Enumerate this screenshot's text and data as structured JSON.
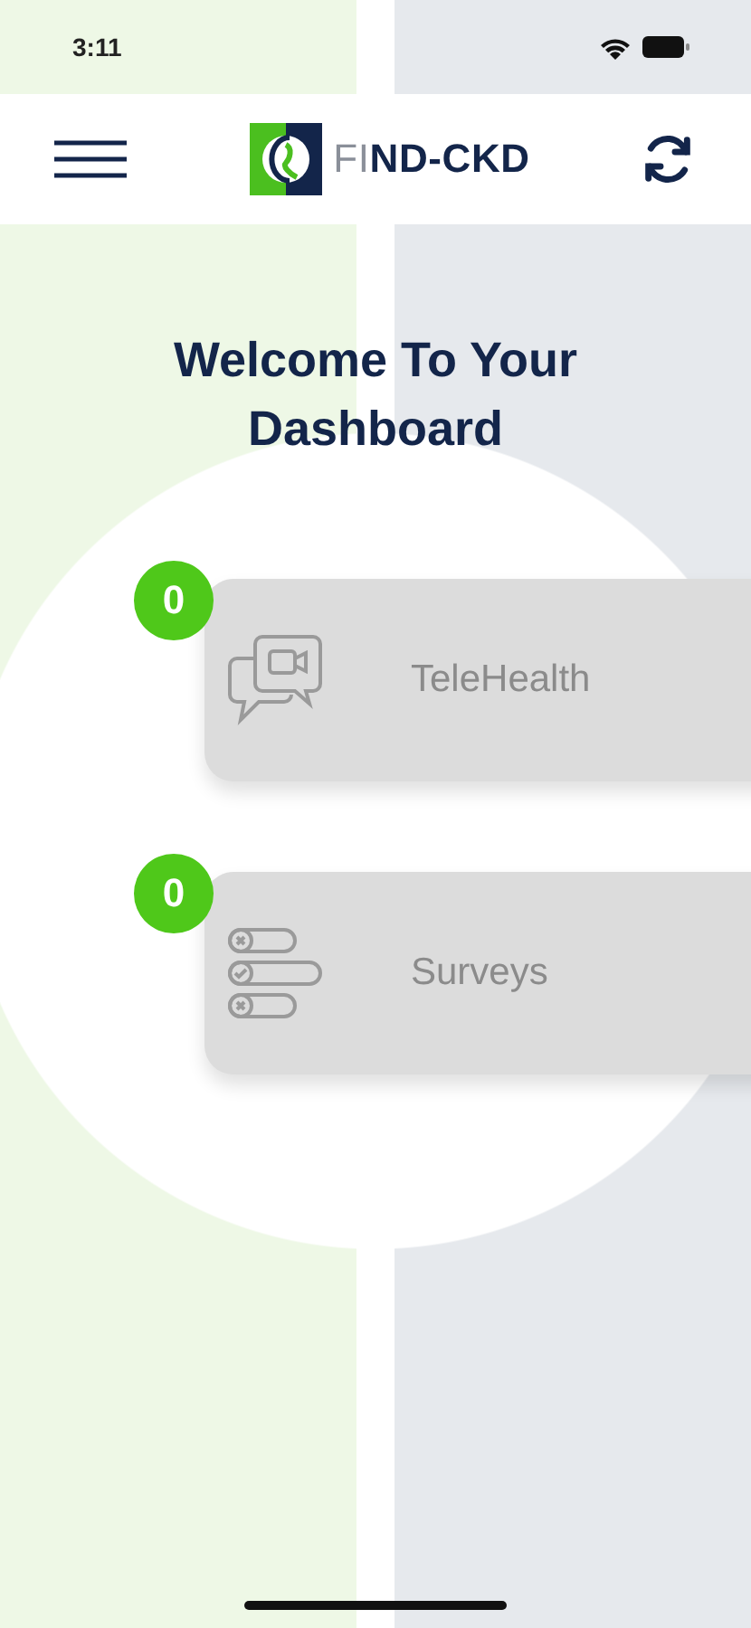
{
  "status_bar": {
    "time": "3:11"
  },
  "header": {
    "app_name": {
      "lead": "FI",
      "rest": "ND-CKD"
    }
  },
  "title": "Welcome To Your Dashboard",
  "cards": [
    {
      "kind": "telehealth",
      "label": "TeleHealth",
      "count": "0"
    },
    {
      "kind": "surveys",
      "label": "Surveys",
      "count": "0"
    }
  ]
}
